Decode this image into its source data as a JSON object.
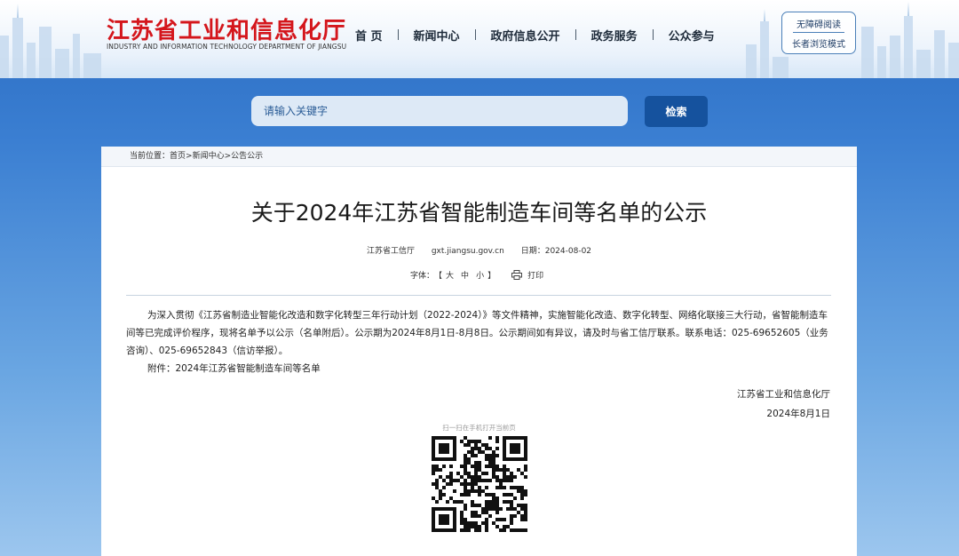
{
  "header": {
    "site_title": "江苏省工业和信息化厅",
    "site_subtitle": "INDUSTRY AND INFORMATION TECHNOLOGY DEPARTMENT OF JIANGSU",
    "nav": [
      {
        "label": "首 页"
      },
      {
        "label": "新闻中心"
      },
      {
        "label": "政府信息公开"
      },
      {
        "label": "政务服务"
      },
      {
        "label": "公众参与"
      }
    ],
    "accessibility": {
      "barrier_free": "无障碍阅读",
      "elder_mode": "长者浏览模式"
    }
  },
  "search": {
    "placeholder": "请输入关键字",
    "button_label": "检索"
  },
  "breadcrumb": {
    "prefix": "当前位置：",
    "items": [
      "首页",
      "新闻中心",
      "公告公示"
    ],
    "separator": ">"
  },
  "article": {
    "title": "关于2024年江苏省智能制造车间等名单的公示",
    "source": "江苏省工信厅",
    "site": "gxt.jiangsu.gov.cn",
    "date_label": "日期：",
    "date": "2024-08-02",
    "font_size_label": "字体：",
    "font_open": "【",
    "font_sizes": [
      "大",
      "中",
      "小"
    ],
    "font_close": "】",
    "print_label": "打印",
    "body": "为深入贯彻《江苏省制造业智能化改造和数字化转型三年行动计划（2022-2024）》等文件精神，实施智能化改造、数字化转型、网络化联接三大行动，省智能制造车间等已完成评价程序，现将名单予以公示（名单附后）。公示期为2024年8月1日-8月8日。公示期间如有异议，请及时与省工信厅联系。联系电话：025-69652605（业务咨询）、025-69652843（信访举报）。",
    "attachment": "附件：2024年江苏省智能制造车间等名单",
    "signer": "江苏省工业和信息化厅",
    "sign_date": "2024年8月1日",
    "qr_caption": "扫一扫在手机打开当前页"
  }
}
